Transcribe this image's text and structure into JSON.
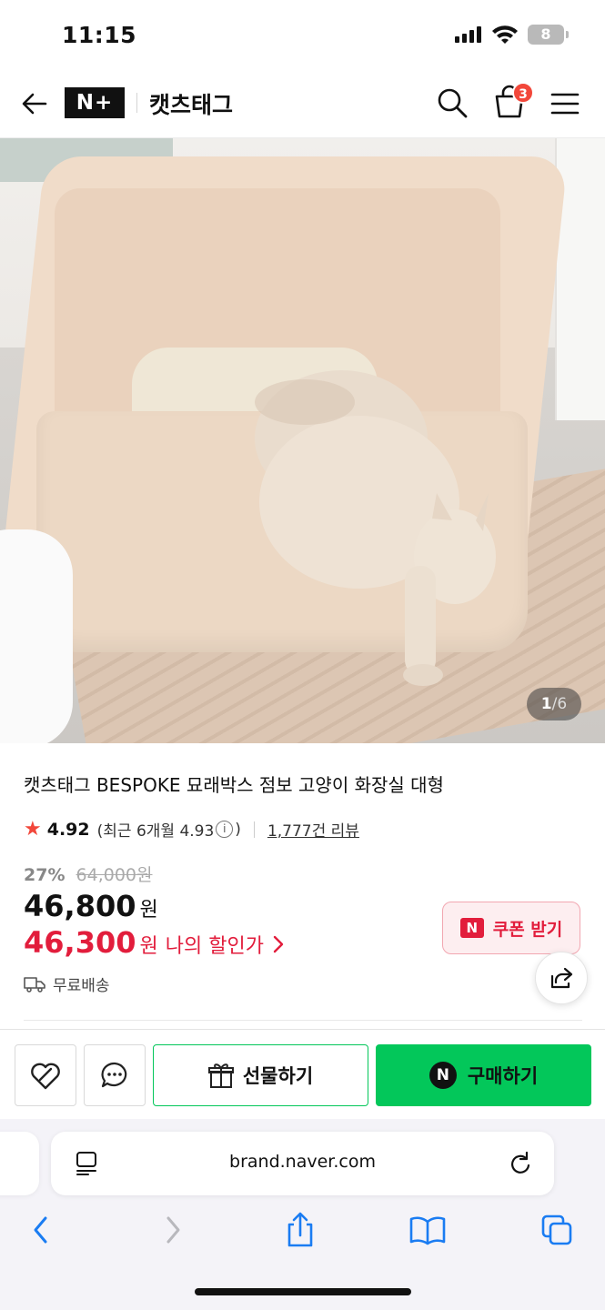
{
  "status_bar": {
    "time": "11:15",
    "battery": "8"
  },
  "header": {
    "logo": "N+",
    "brand": "캣츠태그",
    "cart_count": "3"
  },
  "gallery": {
    "current": "1",
    "separator": "/",
    "total": "6"
  },
  "product": {
    "title": "캣츠태그 BESPOKE 묘래박스 점보 고양이 화장실 대형",
    "rating": "4.92",
    "recent_rating_prefix": "(최근 6개월 4.93",
    "recent_rating_suffix": ")",
    "review_count": "1,777건 리뷰",
    "discount_percent": "27%",
    "original_price": "64,000원",
    "price": "46,800",
    "price_unit": "원",
    "my_price": "46,300",
    "my_price_unit": "원",
    "my_price_label": "나의 할인가",
    "coupon_label": "쿠폰 받기",
    "coupon_badge": "N",
    "shipping": "무료배송"
  },
  "actions": {
    "gift": "선물하기",
    "buy": "구매하기",
    "buy_badge": "N"
  },
  "browser": {
    "url": "brand.naver.com"
  },
  "colors": {
    "naver_green": "#03c75a",
    "discount_red": "#e21d3c",
    "badge_red": "#f2473a"
  }
}
